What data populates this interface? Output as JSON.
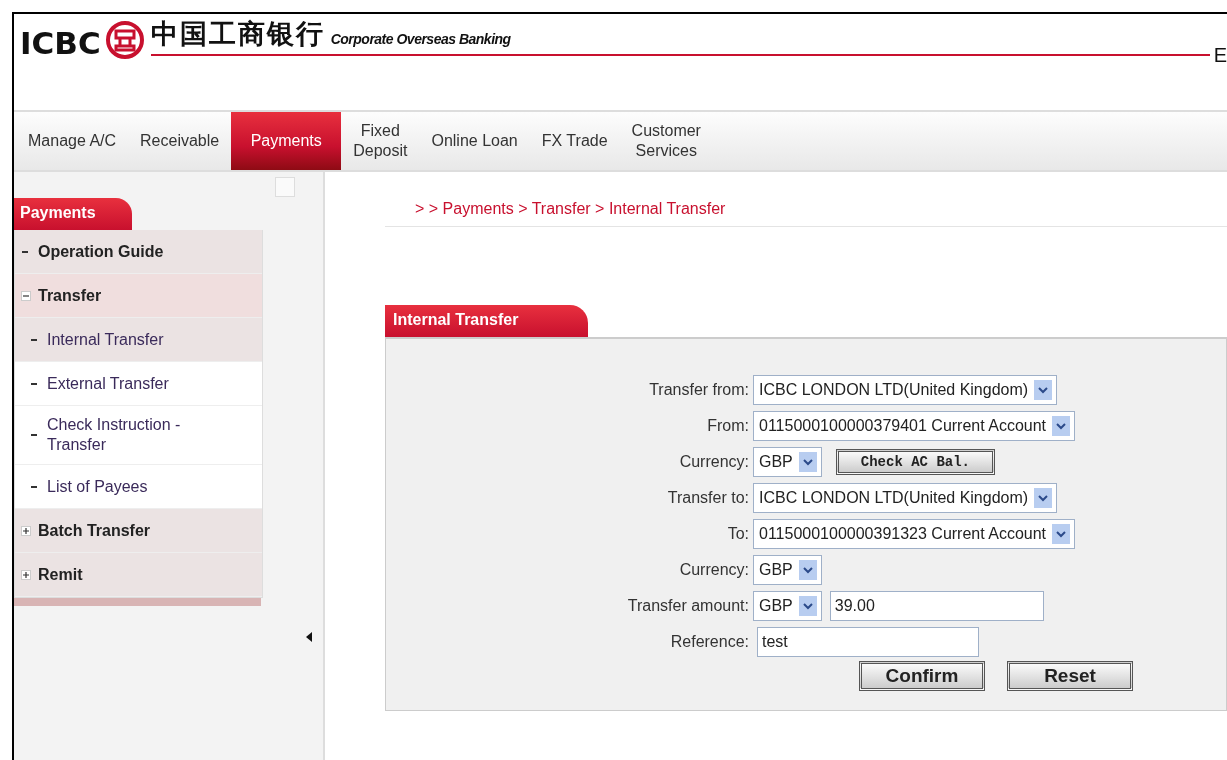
{
  "header": {
    "logo_latin": "ICBC",
    "logo_chinese": "中国工商银行",
    "tagline": "Corporate Overseas Banking",
    "cut_text": "E"
  },
  "nav": {
    "tabs": [
      {
        "label": "Manage A/C",
        "selected": false
      },
      {
        "label": "Receivable",
        "selected": false
      },
      {
        "label": "Payments",
        "selected": true
      },
      {
        "label": "Fixed\nDeposit",
        "selected": false
      },
      {
        "label": "Online Loan",
        "selected": false
      },
      {
        "label": "FX Trade",
        "selected": false
      },
      {
        "label": "Customer\nServices",
        "selected": false
      }
    ]
  },
  "sidebar": {
    "title": "Payments",
    "items": [
      {
        "kind": "link",
        "label": "Operation Guide"
      },
      {
        "kind": "group",
        "label": "Transfer",
        "expanded": true,
        "children": [
          {
            "label": "Internal Transfer",
            "selected": true
          },
          {
            "label": "External Transfer",
            "selected": false
          },
          {
            "label": "Check Instruction -\nTransfer",
            "selected": false
          },
          {
            "label": "List of Payees",
            "selected": false
          }
        ]
      },
      {
        "kind": "group",
        "label": "Batch Transfer",
        "expanded": false
      },
      {
        "kind": "group",
        "label": "Remit",
        "expanded": false
      }
    ]
  },
  "breadcrumb": "> > Payments > Transfer > Internal Transfer",
  "form": {
    "title": "Internal Transfer",
    "fields": [
      {
        "kind": "select",
        "label": "Transfer from:",
        "value": "ICBC LONDON LTD(United Kingdom)"
      },
      {
        "kind": "select",
        "label": "From:",
        "value": "0115000100000379401 Current Account"
      },
      {
        "kind": "select_button",
        "label": "Currency:",
        "value": "GBP",
        "button": "Check AC Bal."
      },
      {
        "kind": "select",
        "label": "Transfer to:",
        "value": "ICBC LONDON LTD(United Kingdom)"
      },
      {
        "kind": "select",
        "label": "To:",
        "value": "0115000100000391323 Current Account"
      },
      {
        "kind": "select",
        "label": "Currency:",
        "value": "GBP"
      },
      {
        "kind": "select_input",
        "label": "Transfer amount:",
        "value": "GBP",
        "input": "39.00"
      },
      {
        "kind": "input",
        "label": "Reference:",
        "value": "test"
      }
    ],
    "buttons": [
      "Confirm",
      "Reset"
    ]
  }
}
